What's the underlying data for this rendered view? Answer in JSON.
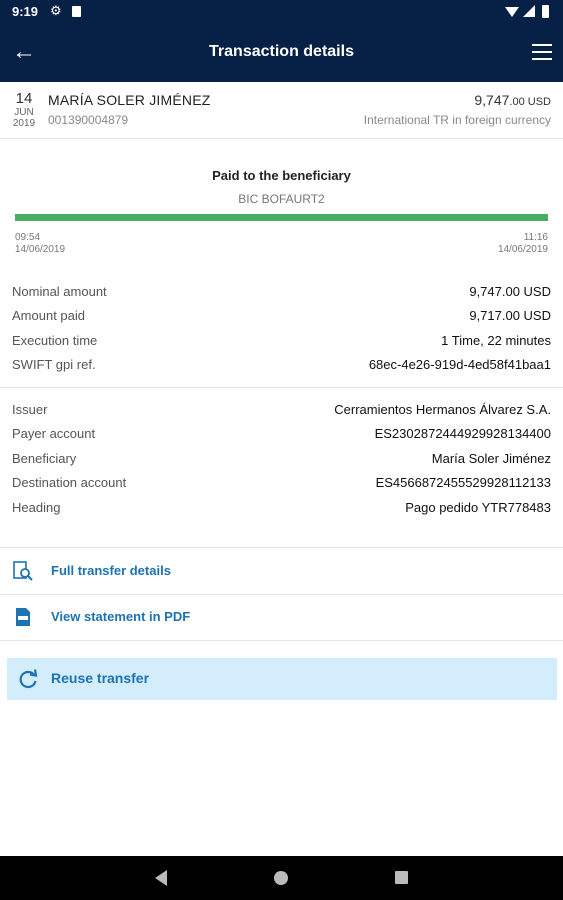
{
  "status_bar": {
    "time": "9:19"
  },
  "app_bar": {
    "title": "Transaction details",
    "back_icon": "arrow-left",
    "menu_icon": "hamburger"
  },
  "header": {
    "date": {
      "day": "14",
      "month": "JUN",
      "year": "2019"
    },
    "name": "MARÍA SOLER JIMÉNEZ",
    "account": "001390004879",
    "amount_main": "9,747",
    "amount_cents": ".00 USD",
    "type": "International TR in foreign currency"
  },
  "timeline": {
    "status": "Paid to the beneficiary",
    "bic": "BIC BOFAURT2",
    "progress": 1.0,
    "start": {
      "time": "09:54",
      "date": "14/06/2019"
    },
    "end": {
      "time": "11:16",
      "date": "14/06/2019"
    },
    "color": "#48ae64"
  },
  "amounts": [
    {
      "label": "Nominal amount",
      "value": "9,747.00 USD"
    },
    {
      "label": "Amount paid",
      "value": "9,717.00 USD"
    },
    {
      "label": "Execution time",
      "value": "1 Time, 22 minutes"
    },
    {
      "label": "SWIFT gpi ref.",
      "value": "68ec-4e26-919d-4ed58f41baa1"
    }
  ],
  "parties": [
    {
      "label": "Issuer",
      "value": "Cerramientos Hermanos Álvarez S.A."
    },
    {
      "label": "Payer account",
      "value": "ES2302872444929928134400"
    },
    {
      "label": "Beneficiary",
      "value": "María Soler Jiménez"
    },
    {
      "label": "Destination account",
      "value": "ES4566872455529928112133"
    },
    {
      "label": "Heading",
      "value": "Pago pedido YTR778483"
    }
  ],
  "actions": {
    "full_details": "Full transfer details",
    "statement_pdf": "View statement in PDF",
    "reuse": "Reuse transfer"
  },
  "colors": {
    "brand": "#072146",
    "link": "#1d73b2",
    "reuse_bg": "#d4edfc"
  }
}
